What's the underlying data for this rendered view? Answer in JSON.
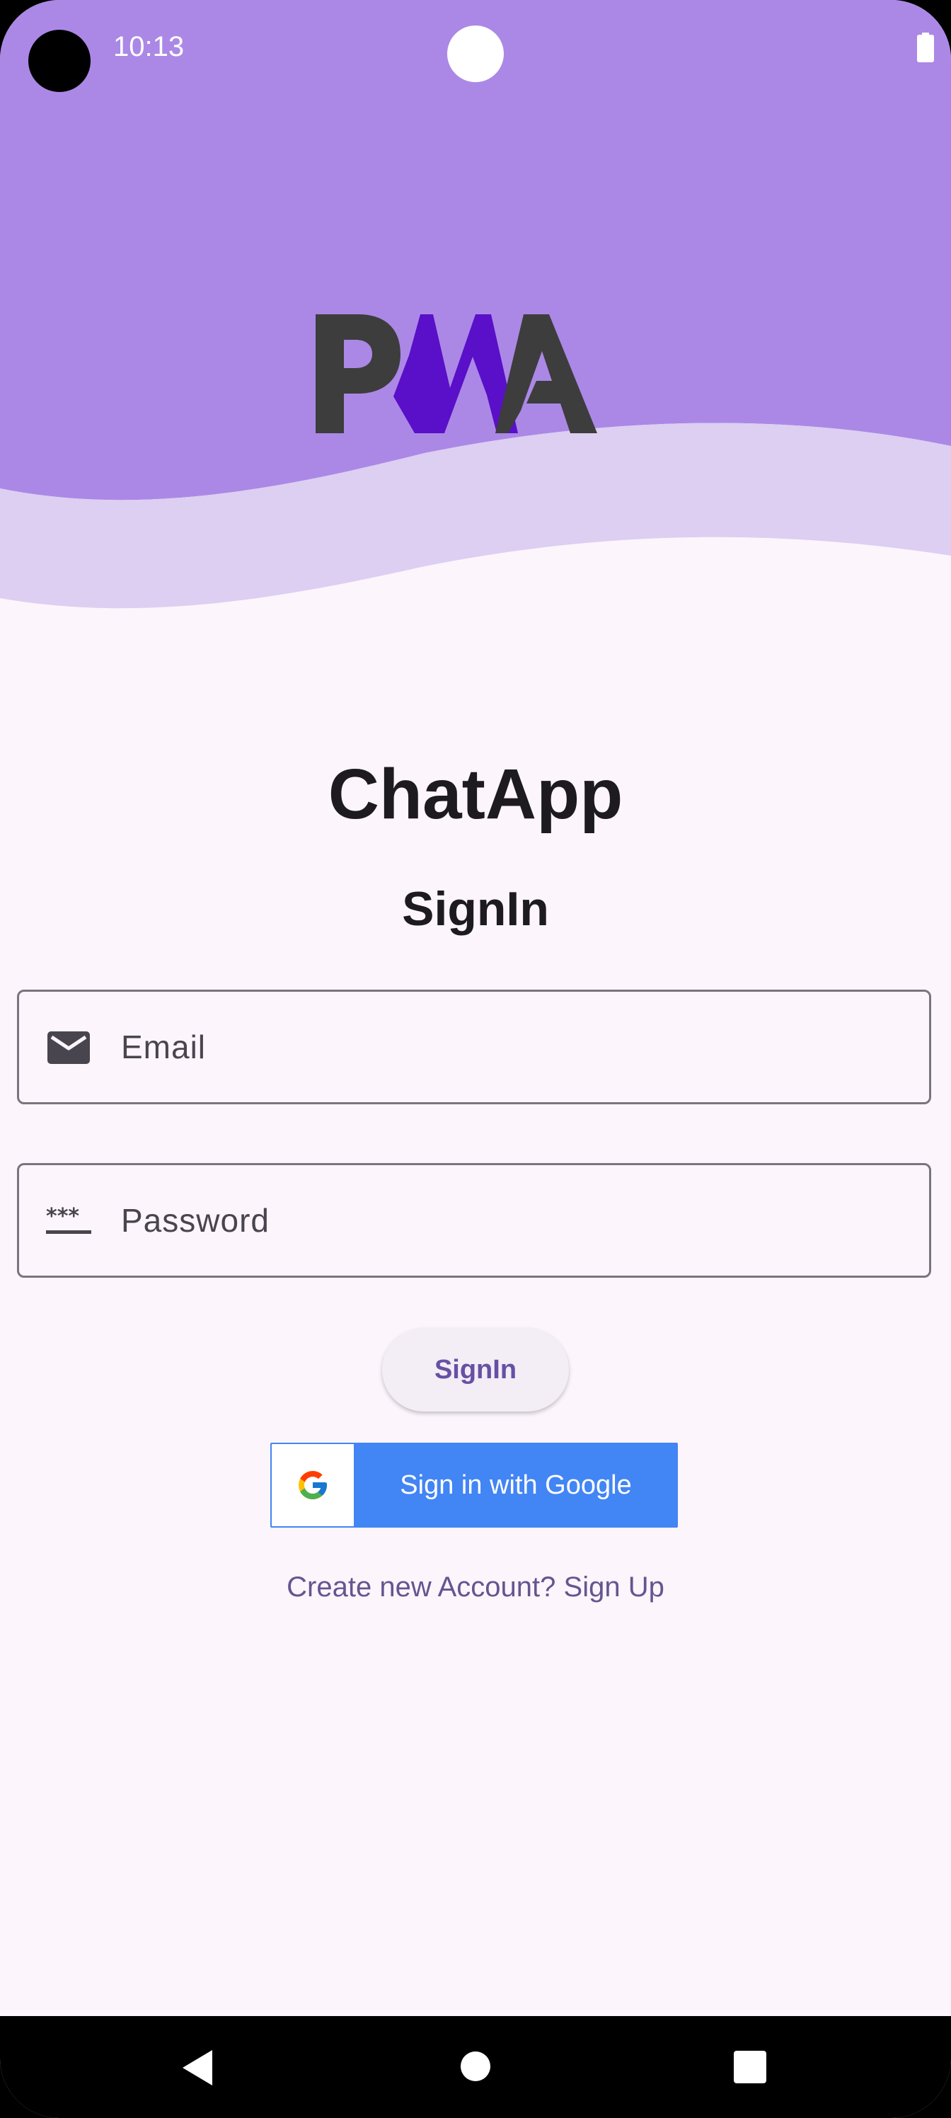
{
  "status_bar": {
    "time": "10:13"
  },
  "header": {
    "logo_name": "pwa-logo",
    "colors": {
      "header_bg": "#ab88e6",
      "wave_light": "#dccff2",
      "logo_dark": "#3d3d3d",
      "logo_purple": "#5a0fc8"
    }
  },
  "main": {
    "app_title": "ChatApp",
    "screen_title": "SignIn",
    "email_field": {
      "placeholder": "Email",
      "icon": "mail-icon"
    },
    "password_field": {
      "placeholder": "Password",
      "icon": "password-icon"
    },
    "signin_button_label": "SignIn",
    "google_button_label": "Sign in with Google",
    "signup_link": "Create new Account? Sign Up"
  },
  "nav_bar": {
    "back": "back-icon",
    "home": "home-icon",
    "recents": "recents-icon"
  },
  "colors": {
    "background": "#fdf5fc",
    "accent": "#6750a4",
    "google_blue": "#4285f4"
  }
}
